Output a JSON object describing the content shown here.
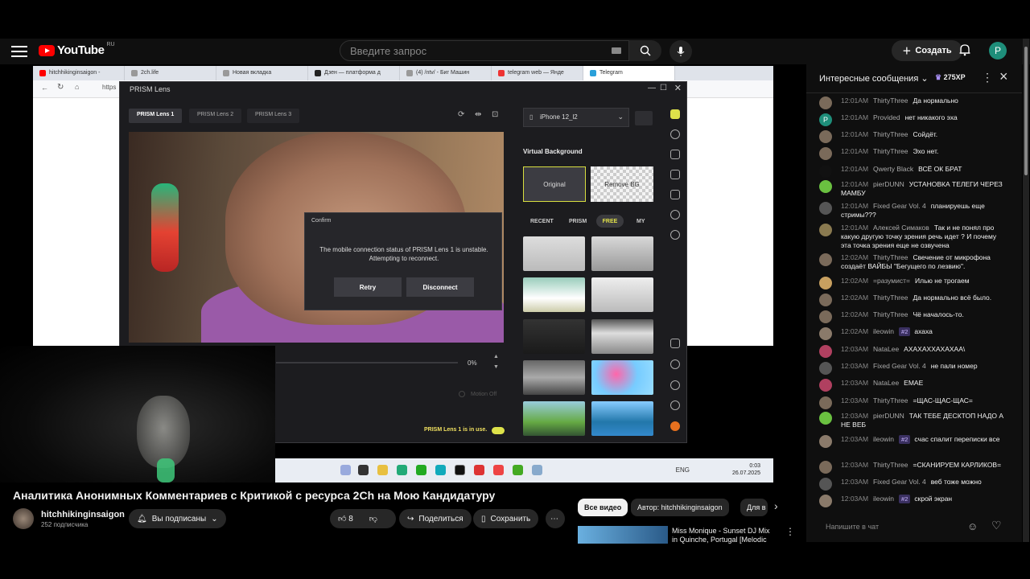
{
  "header": {
    "logo_text": "YouTube",
    "logo_region": "RU",
    "search_placeholder": "Введите запрос",
    "create_label": "Создать",
    "avatar_letter": "P"
  },
  "browser_tabs": [
    {
      "label": "hitchhikinginsaigon - ",
      "color": "#ff0000"
    },
    {
      "label": "2ch.life",
      "color": "#999"
    },
    {
      "label": "Новая вкладка",
      "color": "#999"
    },
    {
      "label": "Дзен — платформа д",
      "color": "#222"
    },
    {
      "label": "(4) /ntv/ - Биг Машин",
      "color": "#999"
    },
    {
      "label": "telegram web — Янде",
      "color": "#e33"
    },
    {
      "label": "Telegram",
      "color": "#2aa0da"
    }
  ],
  "browser_address": "https",
  "prism": {
    "title": "PRISM Lens",
    "tabs": [
      "PRISM Lens 1",
      "PRISM Lens 2",
      "PRISM Lens 3"
    ],
    "device": "iPhone 12_l2",
    "virtual_background_title": "Virtual Background",
    "bg_original": "Original",
    "bg_remove": "Remove BG",
    "categories": [
      "RECENT",
      "PRISM",
      "FREE",
      "MY"
    ],
    "percent": "0%",
    "motion_off": "Motion Off",
    "in_use_text": "PRISM Lens 1 is in use.",
    "confirm": {
      "title": "Confirm",
      "message": "The mobile connection status of PRISM Lens 1 is unstable. Attempting to reconnect.",
      "retry": "Retry",
      "disconnect": "Disconnect"
    }
  },
  "taskbar": {
    "lang": "ENG",
    "time": "0:03",
    "date": "26.07.2025"
  },
  "video": {
    "title": "Аналитика Анонимных Комментариев с Критикой с ресурса 2Ch на Мою Кандидатуру",
    "channel": "hitchhikinginsaigon",
    "subscribers": "252 подписчика",
    "subscribed_label": "Вы подписаны",
    "likes": "8",
    "share_label": "Поделиться",
    "save_label": "Сохранить"
  },
  "filters": [
    "Все видео",
    "Автор: hitchhikinginsaigon",
    "Для в"
  ],
  "recommendation": {
    "title": "Miss Monique - Sunset DJ Mix in Quinche, Portugal [Melodic"
  },
  "chat": {
    "mode": "Интересные сообщения",
    "xp": "275XP",
    "input_placeholder": "Напишите в чат",
    "messages": [
      {
        "time": "12:01AM",
        "author": "ThirtyThree",
        "text": "Да нормально",
        "color": "#7a6a5a"
      },
      {
        "time": "12:01AM",
        "author": "Provided",
        "text": "нет никакого эха",
        "color": "#1e8e7a",
        "letter": "P"
      },
      {
        "time": "12:01AM",
        "author": "ThirtyThree",
        "text": "Сойдёт.",
        "color": "#7a6a5a"
      },
      {
        "time": "12:01AM",
        "author": "ThirtyThree",
        "text": "Эхо нет.",
        "color": "#7a6a5a"
      },
      {
        "time": "12:01AM",
        "author": "Qwerty Black",
        "text": "ВСЁ ОК БРАТ",
        "color": "#111"
      },
      {
        "time": "12:01AM",
        "author": "pierDUNN",
        "text": "УСТАНОВКА ТЕЛЕГИ ЧЕРЕЗ МАМБУ",
        "color": "#6ac040"
      },
      {
        "time": "12:01AM",
        "author": "Fixed Gear Vol. 4",
        "text": "планируешь еще стримы???",
        "color": "#555"
      },
      {
        "time": "12:01AM",
        "author": "Алексей Симаков",
        "text": "Так и не понял про какую другую точку зрения речь идет ? И почему эта точка зрения еще не озвучена",
        "color": "#8a7a50"
      },
      {
        "time": "12:02AM",
        "author": "ThirtyThree",
        "text": "Свечение от микрофона создаёт ВАЙБЫ \"Бегущего по лезвию\".",
        "color": "#7a6a5a"
      },
      {
        "time": "12:02AM",
        "author": "=разумист=",
        "text": "Илью не трогаем",
        "color": "#c8a060"
      },
      {
        "time": "12:02AM",
        "author": "ThirtyThree",
        "text": "Да нормально всё было.",
        "color": "#7a6a5a"
      },
      {
        "time": "12:02AM",
        "author": "ThirtyThree",
        "text": "Чё началось-то.",
        "color": "#7a6a5a"
      },
      {
        "time": "12:02AM",
        "author": "ileowin",
        "badge": "#2",
        "text": "ахаха",
        "color": "#8a7a6a"
      },
      {
        "time": "12:03AM",
        "author": "NataLee",
        "text": "АХАХАХХАХАХАА\\",
        "color": "#b04060"
      },
      {
        "time": "12:03AM",
        "author": "Fixed Gear Vol. 4",
        "text": "не пали номер",
        "color": "#555"
      },
      {
        "time": "12:03AM",
        "author": "NataLee",
        "text": "ЕМАЕ",
        "color": "#b04060"
      },
      {
        "time": "12:03AM",
        "author": "ThirtyThree",
        "text": "=ЩАС-ЩАС-ЩАС=",
        "color": "#7a6a5a"
      },
      {
        "time": "12:03AM",
        "author": "pierDUNN",
        "text": "ТАК ТЕБЕ ДЕСКТОП НАДО А НЕ ВЕБ",
        "color": "#6ac040"
      },
      {
        "time": "12:03AM",
        "author": "ileowin",
        "badge": "#2",
        "text": "счас спалит переписки все",
        "color": "#8a7a6a"
      },
      {
        "time": "12:03AM",
        "author": "ThirtyThree",
        "text": "=СКАНИРУЕМ КАРЛИКОВ=",
        "color": "#7a6a5a"
      },
      {
        "time": "12:03AM",
        "author": "Fixed Gear Vol. 4",
        "text": "веб тоже можно",
        "color": "#555"
      },
      {
        "time": "12:03AM",
        "author": "ileowin",
        "badge": "#2",
        "text": "скрой экран",
        "color": "#8a7a6a"
      }
    ]
  }
}
